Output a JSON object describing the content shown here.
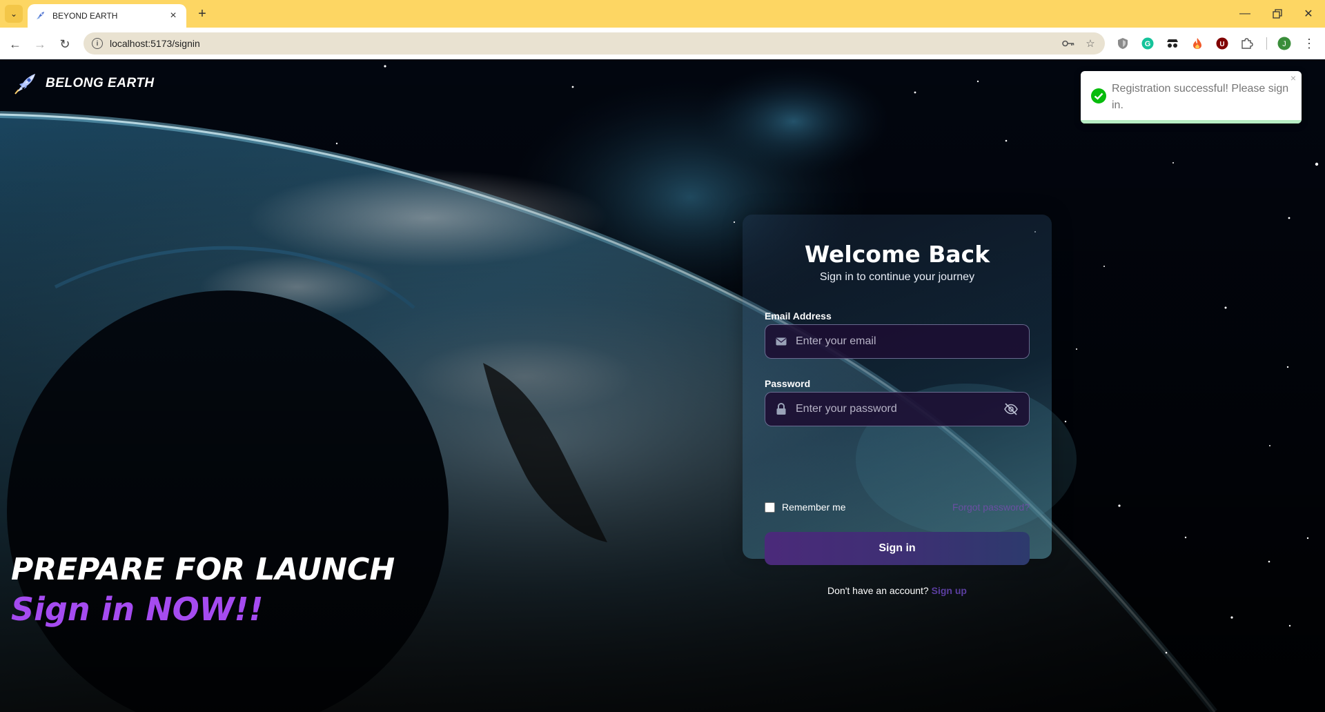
{
  "browser": {
    "tab_title": "BEYOND EARTH",
    "new_tab_label": "+",
    "url": "localhost:5173/signin"
  },
  "brand": {
    "name": "BELONG EARTH"
  },
  "hero": {
    "line1": "PREPARE FOR LAUNCH",
    "line2": "Sign in NOW!!"
  },
  "form": {
    "title": "Welcome Back",
    "subtitle": "Sign in to continue your journey",
    "email_label": "Email Address",
    "email_placeholder": "Enter your email",
    "password_label": "Password",
    "password_placeholder": "Enter your password",
    "remember_label": "Remember me",
    "forgot_label": "Forgot password?",
    "submit_label": "Sign in",
    "signup_prompt": "Don't have an account?",
    "signup_link": "Sign up"
  },
  "toast": {
    "message": "Registration successful! Please sign in.",
    "close_label": "×"
  },
  "profile_initial": "J",
  "colors": {
    "chrome_bg": "#fdd663",
    "accent_purple": "#a54bf0",
    "button_bg": "#3e2f74",
    "toast_success": "#07bc0c"
  }
}
